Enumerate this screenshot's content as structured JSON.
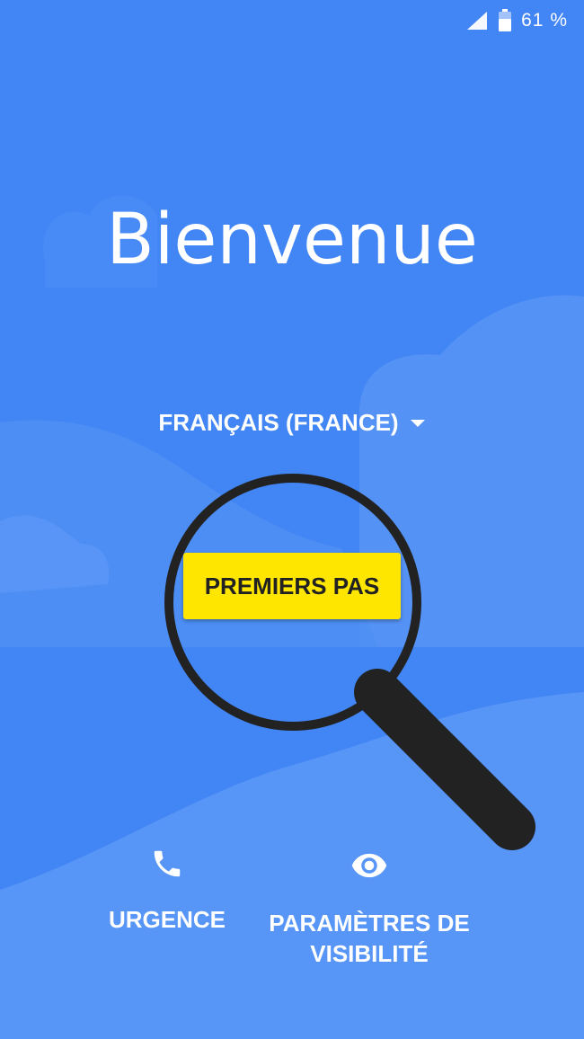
{
  "status_bar": {
    "battery_percent": "61 %",
    "icons": [
      "signal-icon",
      "battery-icon"
    ]
  },
  "welcome": {
    "title": "Bienvenue",
    "language_label": "FRANÇAIS (FRANCE)",
    "start_button": "PREMIERS PAS"
  },
  "bottom_actions": {
    "emergency_label": "URGENCE",
    "accessibility_line1": "PARAMÈTRES DE",
    "accessibility_line2": "VISIBILITÉ"
  },
  "colors": {
    "background": "#4285f4",
    "button": "#ffe600",
    "magnifier": "#222222"
  }
}
